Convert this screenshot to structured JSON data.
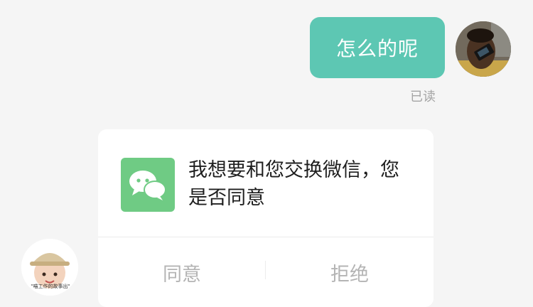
{
  "chat": {
    "outgoing": {
      "text": "怎么的呢",
      "status": "已读"
    },
    "incoming_card": {
      "message": "我想要和您交换微信，您是否同意",
      "agree_label": "同意",
      "reject_label": "拒绝"
    },
    "other_avatar_caption": "\"喵工作的故事出\""
  },
  "colors": {
    "background": "#f5f5f5",
    "outgoing_bubble": "#5dc7b3",
    "wechat_icon": "#6fcb84",
    "card": "#ffffff",
    "button_text": "#b4b4b4"
  },
  "icons": {
    "card_icon": "wechat-chat-bubbles-icon"
  }
}
